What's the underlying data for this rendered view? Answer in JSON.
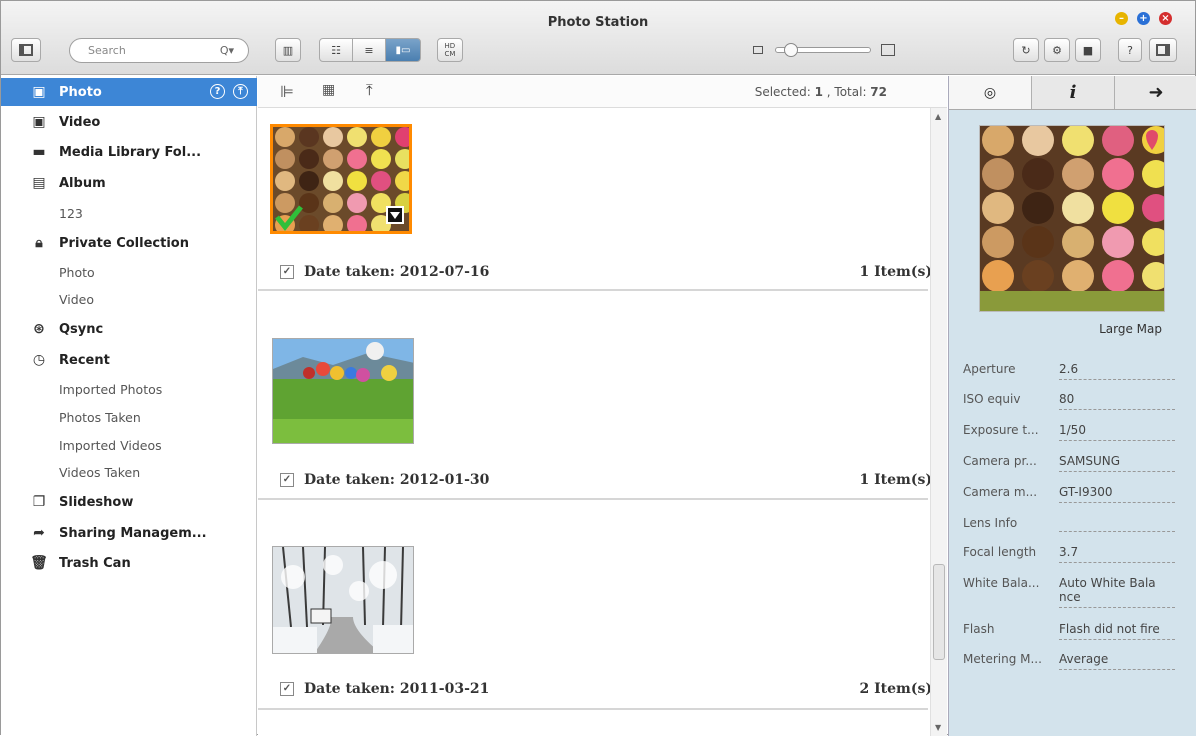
{
  "window": {
    "title": "Photo Station"
  },
  "toolbar": {
    "search_placeholder": "Search",
    "hd_label": "HD\nCM"
  },
  "sidebar": {
    "items": [
      {
        "label": "Photo",
        "icon": "photo-icon"
      },
      {
        "label": "Video",
        "icon": "video-icon"
      },
      {
        "label": "Media Library Fol...",
        "icon": "folder-icon"
      },
      {
        "label": "Album",
        "icon": "album-icon"
      },
      {
        "label": "Private Collection",
        "icon": "lock-icon"
      },
      {
        "label": "Qsync",
        "icon": "qsync-icon"
      },
      {
        "label": "Recent",
        "icon": "clock-icon"
      },
      {
        "label": "Slideshow",
        "icon": "slideshow-icon"
      },
      {
        "label": "Sharing Managem...",
        "icon": "share-icon"
      },
      {
        "label": "Trash Can",
        "icon": "trash-icon"
      }
    ],
    "album_sub": [
      "123"
    ],
    "private_sub": [
      "Photo",
      "Video"
    ],
    "recent_sub": [
      "Imported Photos",
      "Photos Taken",
      "Imported Videos",
      "Videos Taken"
    ]
  },
  "main": {
    "selected_label": "Selected: ",
    "selected": "1",
    "total_label": " , Total: ",
    "total": "72",
    "groups": [
      {
        "date": "Date taken: 2012-07-16",
        "count": "1 Item(s)"
      },
      {
        "date": "Date taken: 2012-01-30",
        "count": "1 Item(s)"
      },
      {
        "date": "Date taken: 2011-03-21",
        "count": "2 Item(s)"
      }
    ]
  },
  "details": {
    "map_link": "Large Map",
    "props": [
      {
        "key": "Aperture",
        "value": "2.6"
      },
      {
        "key": "ISO equiv",
        "value": "80"
      },
      {
        "key": "Exposure t...",
        "value": "1/50"
      },
      {
        "key": "Camera pr...",
        "value": "SAMSUNG"
      },
      {
        "key": "Camera m...",
        "value": "GT-I9300"
      },
      {
        "key": "Lens Info",
        "value": ""
      },
      {
        "key": "Focal length",
        "value": "3.7"
      },
      {
        "key": "White Bala...",
        "value": "Auto White Bala nce"
      },
      {
        "key": "Flash",
        "value": "Flash did not fire"
      },
      {
        "key": "Metering M...",
        "value": "Average"
      }
    ]
  },
  "colors": {
    "accent": "#3d86d6",
    "panel": "#d3e3ec"
  }
}
